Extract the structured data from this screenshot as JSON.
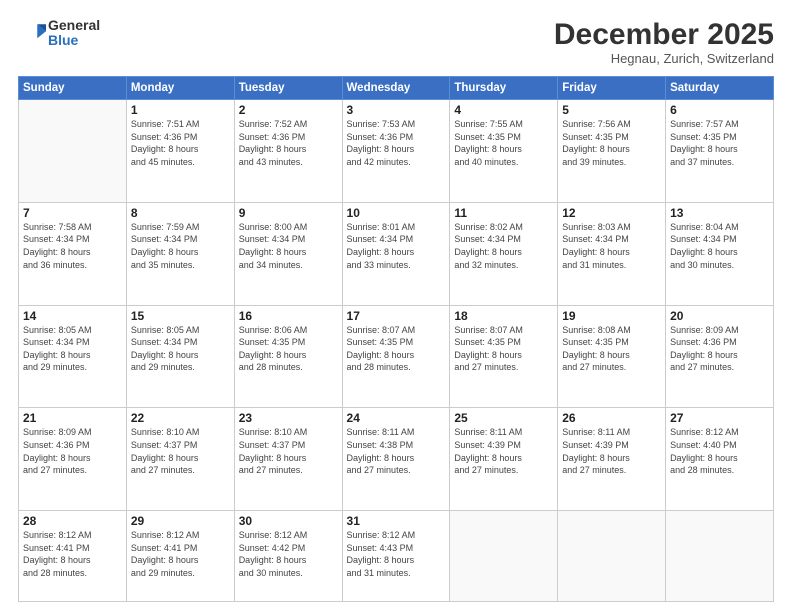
{
  "header": {
    "logo_general": "General",
    "logo_blue": "Blue",
    "title": "December 2025",
    "subtitle": "Hegnau, Zurich, Switzerland"
  },
  "weekdays": [
    "Sunday",
    "Monday",
    "Tuesday",
    "Wednesday",
    "Thursday",
    "Friday",
    "Saturday"
  ],
  "weeks": [
    [
      {
        "day": "",
        "info": ""
      },
      {
        "day": "1",
        "info": "Sunrise: 7:51 AM\nSunset: 4:36 PM\nDaylight: 8 hours\nand 45 minutes."
      },
      {
        "day": "2",
        "info": "Sunrise: 7:52 AM\nSunset: 4:36 PM\nDaylight: 8 hours\nand 43 minutes."
      },
      {
        "day": "3",
        "info": "Sunrise: 7:53 AM\nSunset: 4:36 PM\nDaylight: 8 hours\nand 42 minutes."
      },
      {
        "day": "4",
        "info": "Sunrise: 7:55 AM\nSunset: 4:35 PM\nDaylight: 8 hours\nand 40 minutes."
      },
      {
        "day": "5",
        "info": "Sunrise: 7:56 AM\nSunset: 4:35 PM\nDaylight: 8 hours\nand 39 minutes."
      },
      {
        "day": "6",
        "info": "Sunrise: 7:57 AM\nSunset: 4:35 PM\nDaylight: 8 hours\nand 37 minutes."
      }
    ],
    [
      {
        "day": "7",
        "info": "Sunrise: 7:58 AM\nSunset: 4:34 PM\nDaylight: 8 hours\nand 36 minutes."
      },
      {
        "day": "8",
        "info": "Sunrise: 7:59 AM\nSunset: 4:34 PM\nDaylight: 8 hours\nand 35 minutes."
      },
      {
        "day": "9",
        "info": "Sunrise: 8:00 AM\nSunset: 4:34 PM\nDaylight: 8 hours\nand 34 minutes."
      },
      {
        "day": "10",
        "info": "Sunrise: 8:01 AM\nSunset: 4:34 PM\nDaylight: 8 hours\nand 33 minutes."
      },
      {
        "day": "11",
        "info": "Sunrise: 8:02 AM\nSunset: 4:34 PM\nDaylight: 8 hours\nand 32 minutes."
      },
      {
        "day": "12",
        "info": "Sunrise: 8:03 AM\nSunset: 4:34 PM\nDaylight: 8 hours\nand 31 minutes."
      },
      {
        "day": "13",
        "info": "Sunrise: 8:04 AM\nSunset: 4:34 PM\nDaylight: 8 hours\nand 30 minutes."
      }
    ],
    [
      {
        "day": "14",
        "info": "Sunrise: 8:05 AM\nSunset: 4:34 PM\nDaylight: 8 hours\nand 29 minutes."
      },
      {
        "day": "15",
        "info": "Sunrise: 8:05 AM\nSunset: 4:34 PM\nDaylight: 8 hours\nand 29 minutes."
      },
      {
        "day": "16",
        "info": "Sunrise: 8:06 AM\nSunset: 4:35 PM\nDaylight: 8 hours\nand 28 minutes."
      },
      {
        "day": "17",
        "info": "Sunrise: 8:07 AM\nSunset: 4:35 PM\nDaylight: 8 hours\nand 28 minutes."
      },
      {
        "day": "18",
        "info": "Sunrise: 8:07 AM\nSunset: 4:35 PM\nDaylight: 8 hours\nand 27 minutes."
      },
      {
        "day": "19",
        "info": "Sunrise: 8:08 AM\nSunset: 4:35 PM\nDaylight: 8 hours\nand 27 minutes."
      },
      {
        "day": "20",
        "info": "Sunrise: 8:09 AM\nSunset: 4:36 PM\nDaylight: 8 hours\nand 27 minutes."
      }
    ],
    [
      {
        "day": "21",
        "info": "Sunrise: 8:09 AM\nSunset: 4:36 PM\nDaylight: 8 hours\nand 27 minutes."
      },
      {
        "day": "22",
        "info": "Sunrise: 8:10 AM\nSunset: 4:37 PM\nDaylight: 8 hours\nand 27 minutes."
      },
      {
        "day": "23",
        "info": "Sunrise: 8:10 AM\nSunset: 4:37 PM\nDaylight: 8 hours\nand 27 minutes."
      },
      {
        "day": "24",
        "info": "Sunrise: 8:11 AM\nSunset: 4:38 PM\nDaylight: 8 hours\nand 27 minutes."
      },
      {
        "day": "25",
        "info": "Sunrise: 8:11 AM\nSunset: 4:39 PM\nDaylight: 8 hours\nand 27 minutes."
      },
      {
        "day": "26",
        "info": "Sunrise: 8:11 AM\nSunset: 4:39 PM\nDaylight: 8 hours\nand 27 minutes."
      },
      {
        "day": "27",
        "info": "Sunrise: 8:12 AM\nSunset: 4:40 PM\nDaylight: 8 hours\nand 28 minutes."
      }
    ],
    [
      {
        "day": "28",
        "info": "Sunrise: 8:12 AM\nSunset: 4:41 PM\nDaylight: 8 hours\nand 28 minutes."
      },
      {
        "day": "29",
        "info": "Sunrise: 8:12 AM\nSunset: 4:41 PM\nDaylight: 8 hours\nand 29 minutes."
      },
      {
        "day": "30",
        "info": "Sunrise: 8:12 AM\nSunset: 4:42 PM\nDaylight: 8 hours\nand 30 minutes."
      },
      {
        "day": "31",
        "info": "Sunrise: 8:12 AM\nSunset: 4:43 PM\nDaylight: 8 hours\nand 31 minutes."
      },
      {
        "day": "",
        "info": ""
      },
      {
        "day": "",
        "info": ""
      },
      {
        "day": "",
        "info": ""
      }
    ]
  ]
}
